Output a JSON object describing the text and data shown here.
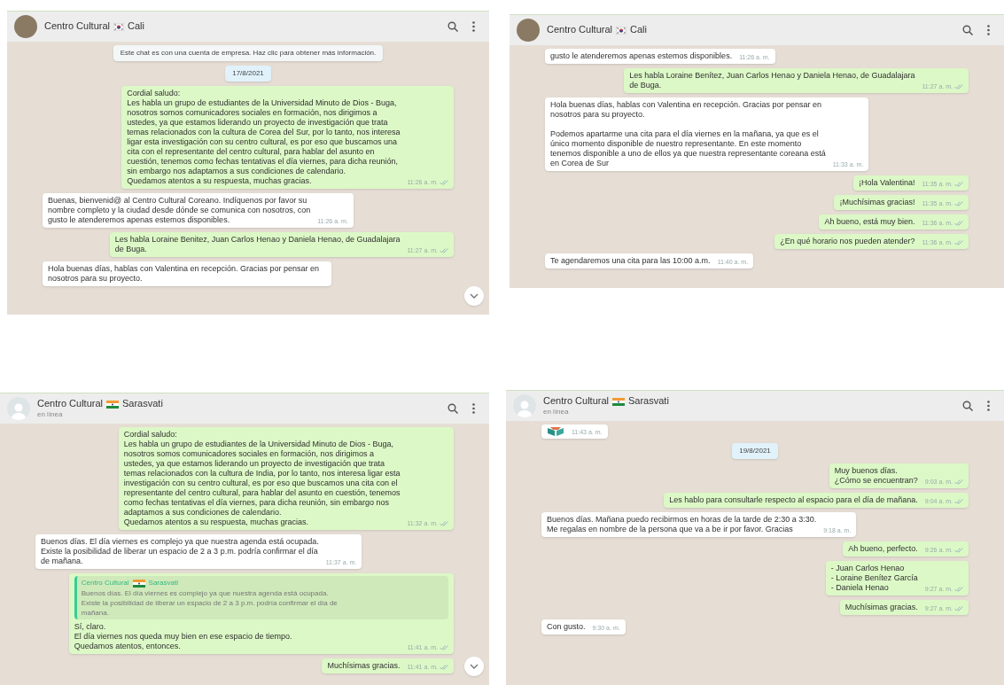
{
  "panels": [
    {
      "title_parts": [
        "Centro Cultural",
        "Cali"
      ],
      "flag": {
        "kind": "korea"
      },
      "avatar": {
        "kind": "photo"
      },
      "scroll_down_button": true,
      "messages": [
        {
          "kind": "system",
          "text": "Este chat es con una cuenta de empresa. Haz clic para obtener más información."
        },
        {
          "kind": "date",
          "text": "17/8/2021"
        },
        {
          "kind": "out",
          "text": "Cordial saludo:\nLes habla un grupo de estudiantes de la Universidad Minuto de Dios - Buga,\nnosotros somos comunicadores sociales en formación, nos dirigimos a\nustedes, ya que estamos liderando un proyecto de investigación que trata\ntemas relacionados con la cultura de Corea del Sur, por lo tanto, nos interesa\nligar esta investigación con su centro cultural, es por eso que buscamos una\ncita con el representante del centro cultural, para hablar del asunto en\ncuestión, tenemos como fechas tentativas el día viernes, para dicha reunión,\nsin embargo nos adaptamos a sus condiciones de calendario.\nQuedamos atentos a su respuesta, muchas gracias.",
          "time": "11:26 a. m."
        },
        {
          "kind": "in",
          "text": "Buenas, bienvenid@ al Centro Cultural Coreano. Indíquenos por favor su\nnombre completo y la ciudad desde dónde se comunica con nosotros, con\ngusto le atenderemos apenas estemos disponibles.",
          "time": "11:26 a. m."
        },
        {
          "kind": "out",
          "text": "Les habla Loraine Benitez, Juan Carlos Henao y Daniela Henao, de Guadalajara\nde Buga.",
          "time": "11:27 a. m."
        },
        {
          "kind": "in",
          "text": "Hola buenas días, hablas con Valentina en recepción. Gracias por pensar en\nnosotros para su proyecto."
        }
      ]
    },
    {
      "title_parts": [
        "Centro Cultural",
        "Cali"
      ],
      "flag": {
        "kind": "korea"
      },
      "avatar": {
        "kind": "photo"
      },
      "scroll_down_button": false,
      "messages": [
        {
          "kind": "in",
          "text": "gusto le atenderemos apenas estemos disponibles.",
          "time": "11:26 a. m."
        },
        {
          "kind": "out",
          "text": "Les habla Loraine Benítez, Juan Carlos Henao y Daniela Henao, de Guadalajara\nde Buga.",
          "time": "11:27 a. m."
        },
        {
          "kind": "in",
          "text": "Hola buenas días, hablas con Valentina en recepción. Gracias por pensar en\nnosotros para su proyecto.\n\nPodemos apartarme una cita para el día viernes en la mañana, ya que es el\núnico momento disponible de nuestro representante. En este momento\ntenemos disponible a uno de ellos ya que nuestra representante coreana está\nen Corea de Sur",
          "time": "11:33 a. m."
        },
        {
          "kind": "out",
          "text": "¡Hola Valentina!",
          "time": "11:35 a. m."
        },
        {
          "kind": "out",
          "text": "¡Muchísimas gracias!",
          "time": "11:35 a. m."
        },
        {
          "kind": "out",
          "text": "Ah bueno, está muy bien.",
          "time": "11:36 a. m."
        },
        {
          "kind": "out",
          "text": "¿En qué horario nos pueden atender?",
          "time": "11:36 a. m."
        },
        {
          "kind": "in",
          "text": "Te agendaremos una cita para las 10:00 a.m.",
          "time": "11:40 a. m."
        }
      ]
    },
    {
      "title_parts": [
        "Centro Cultural",
        "Sarasvati"
      ],
      "flag": {
        "kind": "india"
      },
      "avatar": {
        "kind": "default"
      },
      "subtitle": "en línea",
      "scroll_down_button": true,
      "messages": [
        {
          "kind": "out",
          "text": "Cordial saludo:\nLes habla un grupo de estudiantes de la Universidad Minuto de Dios - Buga,\nnosotros somos comunicadores sociales en formación, nos dirigimos a\nustedes, ya que estamos liderando un proyecto de investigación que trata\ntemas relacionados con la cultura de India, por lo tanto, nos interesa ligar esta\ninvestigación con su centro cultural, es por eso que buscamos una cita con el\nrepresentante del centro cultural, para hablar del asunto en cuestión, tenemos\ncomo fechas tentativas el día viernes, para dicha reunión, sin embargo nos\nadaptamos a sus condiciones de calendario.\nQuedamos atentos a su respuesta, muchas gracias.",
          "time": "11:32 a. m."
        },
        {
          "kind": "in",
          "text": "Buenos días. El día viernes es complejo ya que nuestra agenda está ocupada.\nExiste la posibilidad de liberar un espacio de 2 a 3 p.m. podría confirmar el día\nde mañana.",
          "time": "11:37 a. m."
        },
        {
          "kind": "quote_out",
          "quote_author_parts": [
            "Centro Cultural",
            "Sarasvati"
          ],
          "quote_text": "Buenos días. El día viernes es complejo ya que nuestra agenda está ocupada.\nExiste la posibilidad de liberar un espacio de 2 a 3 p.m. podría confirmar el día de\nmañana.",
          "text": "Sí, claro.\nEl día viernes nos queda muy bien en ese espacio de tiempo.\nQuedamos atentos, entonces.",
          "time": "11:41 a. m."
        },
        {
          "kind": "out",
          "text": "Muchísimas gracias.",
          "time": "11:41 a. m."
        }
      ]
    },
    {
      "title_parts": [
        "Centro Cultural",
        "Sarasvati"
      ],
      "flag": {
        "kind": "india"
      },
      "avatar": {
        "kind": "default"
      },
      "subtitle": "en línea",
      "scroll_down_button": false,
      "messages": [
        {
          "kind": "sticker_in",
          "time": "11:43 a. m."
        },
        {
          "kind": "date",
          "text": "19/8/2021"
        },
        {
          "kind": "out",
          "text": "Muy buenos días.\n¿Cómo se encuentran?",
          "time": "9:03 a. m."
        },
        {
          "kind": "out",
          "text": "Les hablo para consultarle respecto al espacio para el día de mañana.",
          "time": "9:04 a. m."
        },
        {
          "kind": "in",
          "text": "Buenos días. Mañana puedo recibirmos en horas de la tarde de 2:30 a 3:30.\nMe regalas en nombre de la persona que va a be ir por favor. Gracias",
          "time": "9:18 a. m."
        },
        {
          "kind": "out",
          "text": "Ah bueno, perfecto.",
          "time": "9:26 a. m."
        },
        {
          "kind": "out",
          "text": "- Juan Carlos Henao\n- Loraine Benítez García\n- Daniela Henao",
          "time": "9:27 a. m."
        },
        {
          "kind": "out",
          "text": "Muchísimas gracias.",
          "time": "9:27 a. m."
        },
        {
          "kind": "in",
          "text": "Con gusto.",
          "time": "9:30 a. m."
        }
      ]
    }
  ]
}
